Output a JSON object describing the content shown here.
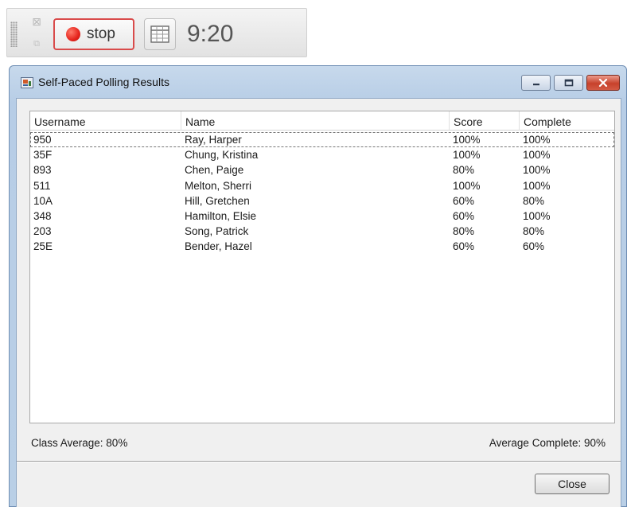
{
  "toolbar": {
    "stop_label": "stop",
    "timer": "9:20",
    "icons": [
      "grip-icon",
      "close-icon",
      "restore-icon",
      "record-dot-icon",
      "table-icon"
    ],
    "accent_color": "#d94b4b"
  },
  "window": {
    "title": "Self-Paced Polling Results",
    "controls": [
      "minimize",
      "maximize",
      "close"
    ]
  },
  "results": {
    "columns": [
      "Username",
      "Name",
      "Score",
      "Complete"
    ],
    "rows": [
      {
        "username": "950",
        "name": "Ray, Harper",
        "score": "100%",
        "complete": "100%"
      },
      {
        "username": "35F",
        "name": "Chung, Kristina",
        "score": "100%",
        "complete": "100%"
      },
      {
        "username": "893",
        "name": "Chen, Paige",
        "score": "80%",
        "complete": "100%"
      },
      {
        "username": "511",
        "name": "Melton, Sherri",
        "score": "100%",
        "complete": "100%"
      },
      {
        "username": "10A",
        "name": "Hill, Gretchen",
        "score": "60%",
        "complete": "80%"
      },
      {
        "username": "348",
        "name": "Hamilton, Elsie",
        "score": "60%",
        "complete": "100%"
      },
      {
        "username": "203",
        "name": "Song, Patrick",
        "score": "80%",
        "complete": "80%"
      },
      {
        "username": "25E",
        "name": "Bender, Hazel",
        "score": "60%",
        "complete": "60%"
      }
    ]
  },
  "summary": {
    "class_average": "Class Average:  80%",
    "average_complete": "Average Complete:  90%"
  },
  "footer": {
    "close_label": "Close"
  }
}
